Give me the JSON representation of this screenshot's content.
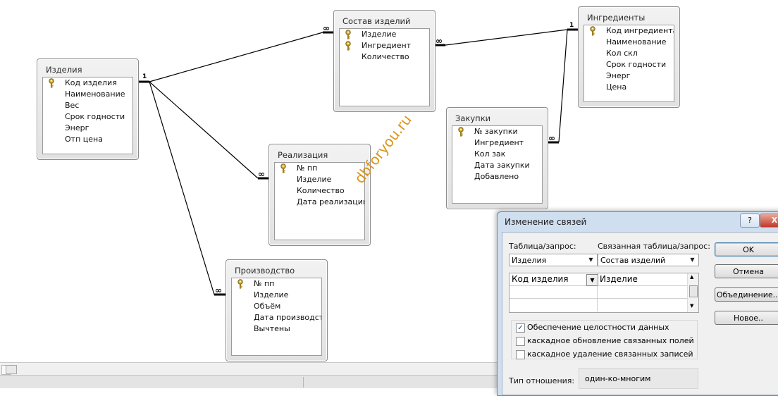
{
  "tables": [
    {
      "id": "izdeliya",
      "title": "Изделия",
      "fields": [
        {
          "name": "Код изделия",
          "key": true
        },
        {
          "name": "Наименование",
          "key": false
        },
        {
          "name": "Вес",
          "key": false
        },
        {
          "name": "Срок годности",
          "key": false
        },
        {
          "name": "Энерг",
          "key": false
        },
        {
          "name": "Отп цена",
          "key": false
        }
      ]
    },
    {
      "id": "sostav",
      "title": "Состав изделий",
      "fields": [
        {
          "name": "Изделие",
          "key": true
        },
        {
          "name": "Ингредиент",
          "key": true
        },
        {
          "name": "Количество",
          "key": false
        }
      ]
    },
    {
      "id": "ingredienty",
      "title": "Ингредиенты",
      "fields": [
        {
          "name": "Код ингредиента",
          "key": true
        },
        {
          "name": "Наименование",
          "key": false
        },
        {
          "name": "Кол скл",
          "key": false
        },
        {
          "name": "Срок годности",
          "key": false
        },
        {
          "name": "Энерг",
          "key": false
        },
        {
          "name": "Цена",
          "key": false
        }
      ]
    },
    {
      "id": "zakupki",
      "title": "Закупки",
      "fields": [
        {
          "name": "№ закупки",
          "key": true
        },
        {
          "name": "Ингредиент",
          "key": false
        },
        {
          "name": "Кол зак",
          "key": false
        },
        {
          "name": "Дата закупки",
          "key": false
        },
        {
          "name": "Добавлено",
          "key": false
        }
      ]
    },
    {
      "id": "realizaciya",
      "title": "Реализация",
      "fields": [
        {
          "name": "№ пп",
          "key": true
        },
        {
          "name": "Изделие",
          "key": false
        },
        {
          "name": "Количество",
          "key": false
        },
        {
          "name": "Дата реализации",
          "key": false
        }
      ]
    },
    {
      "id": "proizvodstvo",
      "title": "Производство",
      "fields": [
        {
          "name": "№ пп",
          "key": true
        },
        {
          "name": "Изделие",
          "key": false
        },
        {
          "name": "Объём",
          "key": false
        },
        {
          "name": "Дата производства",
          "key": false
        },
        {
          "name": "Вычтены",
          "key": false
        }
      ]
    }
  ],
  "relations": [
    {
      "from": "izdeliya",
      "to": "sostav",
      "one": "1",
      "many": "∞"
    },
    {
      "from": "ingredienty",
      "to": "sostav",
      "one": "1",
      "many": "∞"
    },
    {
      "from": "ingredienty",
      "to": "zakupki",
      "one": "1",
      "many": "∞"
    },
    {
      "from": "izdeliya",
      "to": "realizaciya",
      "one": "1",
      "many": "∞"
    },
    {
      "from": "izdeliya",
      "to": "proizvodstvo",
      "one": "1",
      "many": "∞"
    }
  ],
  "watermark": "dbforyou.ru",
  "dialog": {
    "title": "Изменение связей",
    "help_label": "?",
    "close_label": "X",
    "table_query_label": "Таблица/запрос:",
    "related_table_label": "Связанная таблица/запрос:",
    "table_value": "Изделия",
    "related_value": "Состав изделий",
    "grid_left": "Код изделия",
    "grid_right": "Изделие",
    "enforce_label": "Обеспечение целостности данных",
    "enforce_checked": true,
    "cascade_update_label": "каскадное обновление связанных полей",
    "cascade_update_checked": false,
    "cascade_delete_label": "каскадное удаление связанных записей",
    "cascade_delete_checked": false,
    "ok_label": "OK",
    "cancel_label": "Отмена",
    "join_label": "Объединение...",
    "new_label": "Новое..",
    "rel_type_label": "Тип отношения:",
    "rel_type_value": "один-ко-многим"
  },
  "icons": {
    "key": "key-icon",
    "check": "checkmark-icon"
  }
}
